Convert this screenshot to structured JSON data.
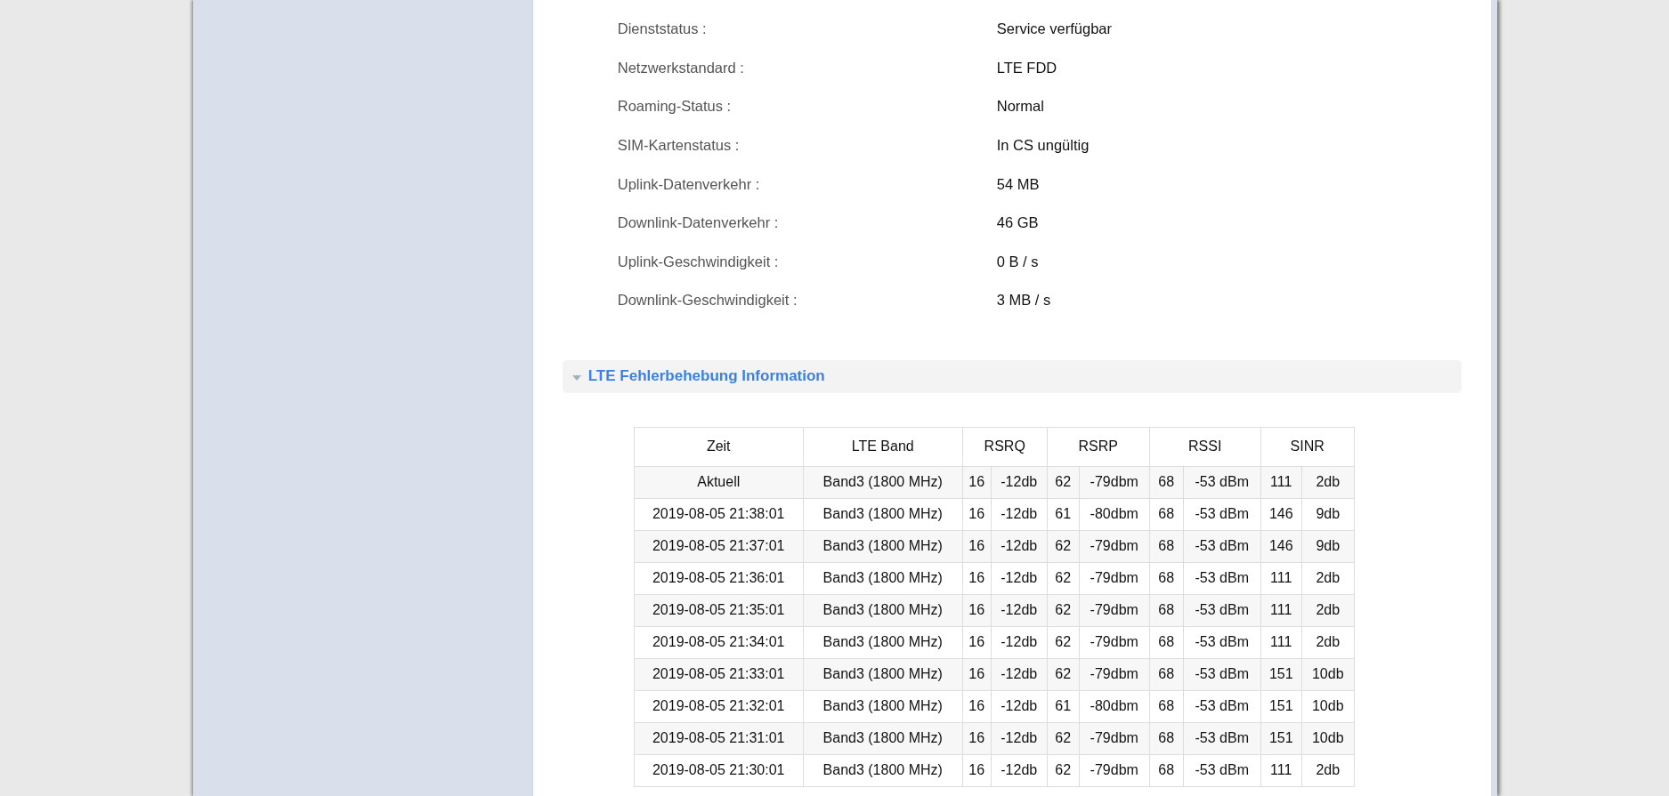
{
  "status_rows": [
    {
      "label": "Dienststatus :",
      "value": "Service verfügbar"
    },
    {
      "label": "Netzwerkstandard :",
      "value": "LTE FDD"
    },
    {
      "label": "Roaming-Status :",
      "value": "Normal"
    },
    {
      "label": "SIM-Kartenstatus :",
      "value": "In CS ungültig"
    },
    {
      "label": "Uplink-Datenverkehr :",
      "value": "54 MB"
    },
    {
      "label": "Downlink-Datenverkehr :",
      "value": "46 GB"
    },
    {
      "label": "Uplink-Geschwindigkeit :",
      "value": "0 B / s"
    },
    {
      "label": "Downlink-Geschwindigkeit :",
      "value": "3 MB / s"
    }
  ],
  "section": {
    "title": "LTE Fehlerbehebung Information",
    "expanded": true
  },
  "table": {
    "columns": [
      "Zeit",
      "LTE Band",
      "RSRQ",
      "RSRP",
      "RSSI",
      "SINR"
    ],
    "rows": [
      [
        "Aktuell",
        "Band3 (1800 MHz)",
        [
          "16",
          "-12db"
        ],
        [
          "62",
          "-79dbm"
        ],
        [
          "68",
          "-53 dBm"
        ],
        [
          "111",
          "2db"
        ]
      ],
      [
        "2019-08-05 21:38:01",
        "Band3 (1800 MHz)",
        [
          "16",
          "-12db"
        ],
        [
          "61",
          "-80dbm"
        ],
        [
          "68",
          "-53 dBm"
        ],
        [
          "146",
          "9db"
        ]
      ],
      [
        "2019-08-05 21:37:01",
        "Band3 (1800 MHz)",
        [
          "16",
          "-12db"
        ],
        [
          "62",
          "-79dbm"
        ],
        [
          "68",
          "-53 dBm"
        ],
        [
          "146",
          "9db"
        ]
      ],
      [
        "2019-08-05 21:36:01",
        "Band3 (1800 MHz)",
        [
          "16",
          "-12db"
        ],
        [
          "62",
          "-79dbm"
        ],
        [
          "68",
          "-53 dBm"
        ],
        [
          "111",
          "2db"
        ]
      ],
      [
        "2019-08-05 21:35:01",
        "Band3 (1800 MHz)",
        [
          "16",
          "-12db"
        ],
        [
          "62",
          "-79dbm"
        ],
        [
          "68",
          "-53 dBm"
        ],
        [
          "111",
          "2db"
        ]
      ],
      [
        "2019-08-05 21:34:01",
        "Band3 (1800 MHz)",
        [
          "16",
          "-12db"
        ],
        [
          "62",
          "-79dbm"
        ],
        [
          "68",
          "-53 dBm"
        ],
        [
          "111",
          "2db"
        ]
      ],
      [
        "2019-08-05 21:33:01",
        "Band3 (1800 MHz)",
        [
          "16",
          "-12db"
        ],
        [
          "62",
          "-79dbm"
        ],
        [
          "68",
          "-53 dBm"
        ],
        [
          "151",
          "10db"
        ]
      ],
      [
        "2019-08-05 21:32:01",
        "Band3 (1800 MHz)",
        [
          "16",
          "-12db"
        ],
        [
          "61",
          "-80dbm"
        ],
        [
          "68",
          "-53 dBm"
        ],
        [
          "151",
          "10db"
        ]
      ],
      [
        "2019-08-05 21:31:01",
        "Band3 (1800 MHz)",
        [
          "16",
          "-12db"
        ],
        [
          "62",
          "-79dbm"
        ],
        [
          "68",
          "-53 dBm"
        ],
        [
          "151",
          "10db"
        ]
      ],
      [
        "2019-08-05 21:30:01",
        "Band3 (1800 MHz)",
        [
          "16",
          "-12db"
        ],
        [
          "62",
          "-79dbm"
        ],
        [
          "68",
          "-53 dBm"
        ],
        [
          "111",
          "2db"
        ]
      ]
    ]
  }
}
